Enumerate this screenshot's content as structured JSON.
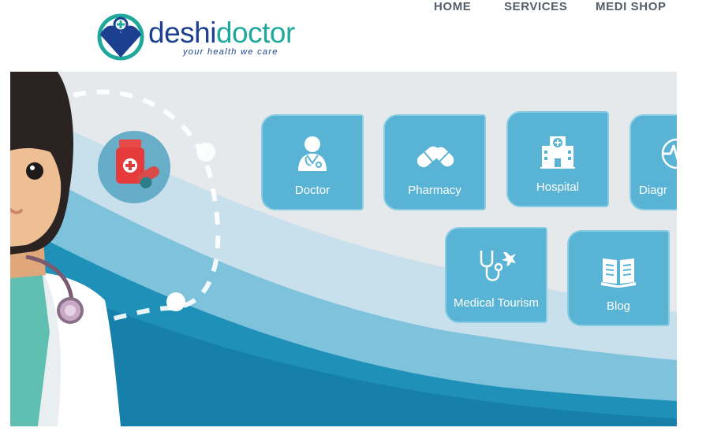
{
  "header": {
    "logo": {
      "word_part1": "deshi",
      "word_part2": "doctor",
      "tagline": "your health we care"
    },
    "nav": [
      {
        "label": "HOME"
      },
      {
        "label": "SERVICES"
      },
      {
        "label": "MEDI SHOP"
      }
    ]
  },
  "services": [
    {
      "label": "Doctor",
      "icon": "doctor-icon"
    },
    {
      "label": "Pharmacy",
      "icon": "pills-icon"
    },
    {
      "label": "Hospital",
      "icon": "hospital-icon"
    },
    {
      "label": "Diagr",
      "icon": "diagnostic-icon"
    },
    {
      "label": "Medical Tourism",
      "icon": "stethoscope-plane-icon"
    },
    {
      "label": "Blog",
      "icon": "book-icon"
    }
  ],
  "colors": {
    "brand_blue": "#1d3f8f",
    "brand_teal": "#1fa89c",
    "tile_bg": "#58b3d4",
    "nav_text": "#555d66"
  }
}
